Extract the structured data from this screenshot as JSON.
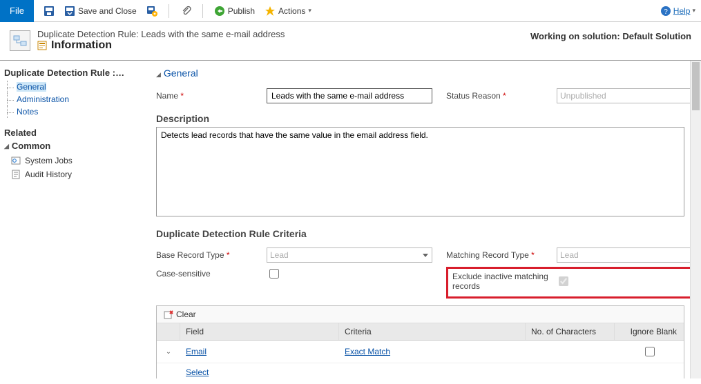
{
  "toolbar": {
    "file": "File",
    "save_close": "Save and Close",
    "publish": "Publish",
    "actions": "Actions",
    "help": "Help"
  },
  "header": {
    "line1": "Duplicate Detection Rule: Leads with the same e-mail address",
    "line2": "Information",
    "solution_label": "Working on solution:",
    "solution_name": "Default Solution"
  },
  "sidebar": {
    "title": "Duplicate Detection Rule :…",
    "tree": [
      "General",
      "Administration",
      "Notes"
    ],
    "related": "Related",
    "common": "Common",
    "nav": [
      "System Jobs",
      "Audit History"
    ]
  },
  "form": {
    "section": "General",
    "name_label": "Name",
    "name_value": "Leads with the same e-mail address",
    "status_label": "Status Reason",
    "status_value": "Unpublished",
    "desc_label": "Description",
    "desc_value": "Detects lead records that have the same value in the email address field.",
    "criteria_header": "Duplicate Detection Rule Criteria",
    "base_label": "Base Record Type",
    "base_value": "Lead",
    "match_label": "Matching Record Type",
    "match_value": "Lead",
    "case_label": "Case-sensitive",
    "exclude_label": "Exclude inactive matching records",
    "grid": {
      "clear": "Clear",
      "h_field": "Field",
      "h_criteria": "Criteria",
      "h_noc": "No. of Characters",
      "h_ignore": "Ignore Blank",
      "rows": [
        {
          "field": "Email",
          "criteria": "Exact Match"
        }
      ],
      "select": "Select"
    }
  }
}
